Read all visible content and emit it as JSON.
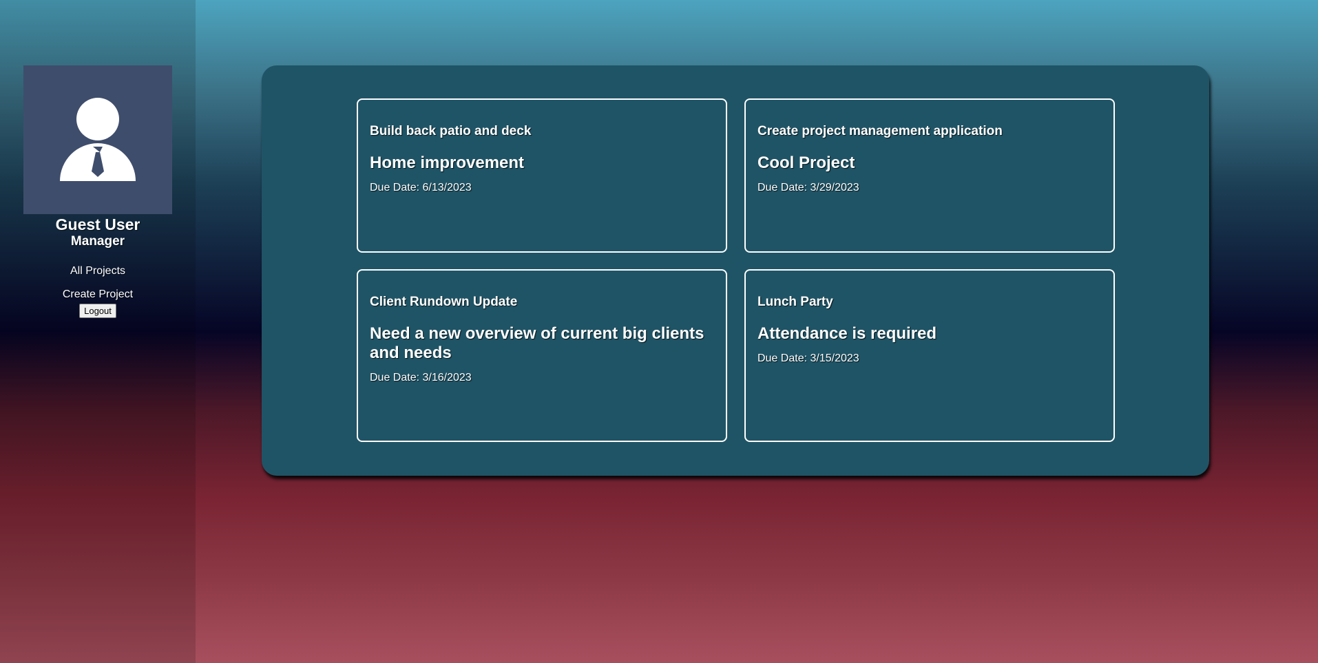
{
  "sidebar": {
    "avatar_icon": "user-avatar-icon",
    "avatar_bg": "#3f4d6c",
    "user_name": "Guest User",
    "user_role": "Manager",
    "nav": {
      "all_projects": "All Projects",
      "create_project": "Create Project"
    },
    "logout_label": "Logout"
  },
  "projects": [
    {
      "title": "Build back patio and deck",
      "description": "Home improvement",
      "due": "Due Date: 6/13/2023"
    },
    {
      "title": "Create project management application",
      "description": "Cool Project",
      "due": "Due Date: 3/29/2023"
    },
    {
      "title": "Client Rundown Update",
      "description": "Need a new overview of current big clients and needs",
      "due": "Due Date: 3/16/2023"
    },
    {
      "title": "Lunch Party",
      "description": "Attendance is required",
      "due": "Due Date: 3/15/2023"
    }
  ],
  "colors": {
    "panel": "#1f5466",
    "card_border": "#ffffff",
    "text": "#ffffff"
  }
}
